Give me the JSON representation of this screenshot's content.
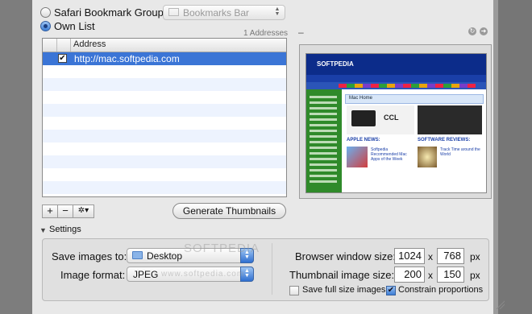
{
  "source_group": {
    "radio_label": "Safari Bookmark Group:",
    "popup_value": "Bookmarks Bar"
  },
  "own_list": {
    "radio_label": "Own List",
    "count_text": "1 Addresses",
    "column_header": "Address",
    "rows": [
      {
        "checked": true,
        "url": "http://mac.softpedia.com"
      }
    ]
  },
  "list_buttons": {
    "add": "+",
    "remove": "−",
    "action": "✲▾"
  },
  "generate_button": "Generate Thumbnails",
  "preview": {
    "dash": "–",
    "site_name": "SOFTPEDIA",
    "page_heading": "Mac Home",
    "apple_news": "APPLE NEWS:",
    "software_reviews": "SOFTWARE REVIEWS:",
    "news_headline": "Softpedia Recommended Mac Apps of the Week",
    "review_headline": "Track Time around the World"
  },
  "settings": {
    "disclosure_label": "Settings",
    "save_images_label": "Save images to:",
    "save_images_value": "Desktop",
    "format_label": "Image format:",
    "format_value": "JPEG",
    "browser_size_label": "Browser window size:",
    "browser_width": "1024",
    "browser_height": "768",
    "thumb_size_label": "Thumbnail image size:",
    "thumb_width": "200",
    "thumb_height": "150",
    "times": "x",
    "unit": "px",
    "save_full_label": "Save full size images",
    "save_full_checked": false,
    "constrain_label": "Constrain proportions",
    "constrain_checked": true
  },
  "watermarks": {
    "large": "SOFTPEDIA",
    "small": "www.softpedia.com"
  }
}
